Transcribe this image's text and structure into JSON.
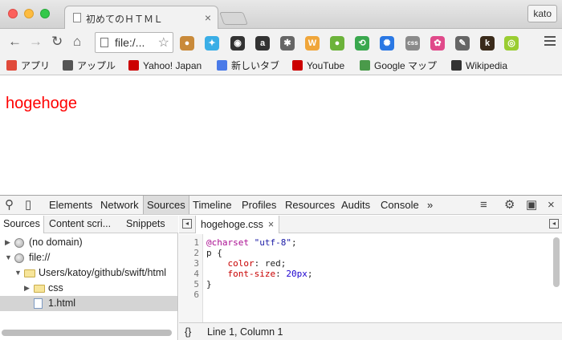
{
  "window": {
    "tab_title": "初めてのＨＴＭＬ",
    "profile": "kato"
  },
  "toolbar": {
    "url": "file:/...",
    "extensions": [
      {
        "name": "cookie-extension-icon",
        "color": "#c98a3a",
        "glyph": "●"
      },
      {
        "name": "twitter-extension-icon",
        "color": "#3aaee6",
        "glyph": "✦"
      },
      {
        "name": "camera-extension-icon",
        "color": "#333333",
        "glyph": "◉"
      },
      {
        "name": "amazon-extension-icon",
        "color": "#333333",
        "glyph": "a"
      },
      {
        "name": "bug-extension-icon",
        "color": "#666666",
        "glyph": "✱"
      },
      {
        "name": "w-extension-icon",
        "color": "#f0a63a",
        "glyph": "W"
      },
      {
        "name": "green-circle-extension-icon",
        "color": "#6cb33a",
        "glyph": "●"
      },
      {
        "name": "evernote-extension-icon",
        "color": "#3aa84e",
        "glyph": "⟲"
      },
      {
        "name": "gear-extension-icon",
        "color": "#2a78e4",
        "glyph": "✺"
      },
      {
        "name": "css-extension-icon",
        "color": "#8a8a8a",
        "glyph": "css"
      },
      {
        "name": "color-wheel-extension-icon",
        "color": "#e04a8a",
        "glyph": "✿"
      },
      {
        "name": "eyedropper-extension-icon",
        "color": "#666666",
        "glyph": "✎"
      },
      {
        "name": "k-extension-icon",
        "color": "#3a2a1a",
        "glyph": "k"
      },
      {
        "name": "screenshot-extension-icon",
        "color": "#9acd32",
        "glyph": "◎"
      }
    ]
  },
  "bookmarks": [
    {
      "label": "アプリ",
      "name": "bookmark-apps",
      "icon_color": "#e04a3a"
    },
    {
      "label": "アップル",
      "name": "bookmark-apple",
      "icon_color": "#555555"
    },
    {
      "label": "Yahoo! Japan",
      "name": "bookmark-yahoo",
      "icon_color": "#cc0000"
    },
    {
      "label": "新しいタブ",
      "name": "bookmark-new-tab",
      "icon_color": "#4a7ae8"
    },
    {
      "label": "YouTube",
      "name": "bookmark-youtube",
      "icon_color": "#cc0000"
    },
    {
      "label": "Google マップ",
      "name": "bookmark-google-maps",
      "icon_color": "#4a9a4a"
    },
    {
      "label": "Wikipedia",
      "name": "bookmark-wikipedia",
      "icon_color": "#333333"
    }
  ],
  "page": {
    "text": "hogehoge"
  },
  "devtools": {
    "tabs": [
      "Elements",
      "Network",
      "Sources",
      "Timeline",
      "Profiles",
      "Resources",
      "Audits",
      "Console"
    ],
    "active_tab": "Sources",
    "more": "»",
    "navigator_tabs": [
      "Sources",
      "Content scri...",
      "Snippets"
    ],
    "tree": [
      {
        "label": "(no domain)",
        "depth": 0,
        "kind": "globe",
        "expanded": false,
        "selected": false
      },
      {
        "label": "file://",
        "depth": 0,
        "kind": "globe",
        "expanded": true,
        "selected": false
      },
      {
        "label": "Users/katoy/github/swift/html",
        "depth": 1,
        "kind": "folder",
        "expanded": true,
        "selected": false
      },
      {
        "label": "css",
        "depth": 2,
        "kind": "folder",
        "expanded": false,
        "selected": false
      },
      {
        "label": "1.html",
        "depth": 2,
        "kind": "file",
        "expanded": null,
        "selected": true
      }
    ],
    "file_tab": "hogehoge.css",
    "code": [
      [
        {
          "t": "@charset",
          "c": "c-at"
        },
        {
          "t": " ",
          "c": ""
        },
        {
          "t": "\"utf-8\"",
          "c": "c-str"
        },
        {
          "t": ";",
          "c": ""
        }
      ],
      [
        {
          "t": "p {",
          "c": ""
        }
      ],
      [
        {
          "t": "    ",
          "c": ""
        },
        {
          "t": "color",
          "c": "c-prop"
        },
        {
          "t": ": red;",
          "c": ""
        }
      ],
      [
        {
          "t": "    ",
          "c": ""
        },
        {
          "t": "font-size",
          "c": "c-prop"
        },
        {
          "t": ": ",
          "c": ""
        },
        {
          "t": "20px",
          "c": "c-num"
        },
        {
          "t": ";",
          "c": ""
        }
      ],
      [
        {
          "t": "}",
          "c": ""
        }
      ],
      []
    ],
    "status_braces": "{}",
    "status": "Line 1, Column 1"
  }
}
